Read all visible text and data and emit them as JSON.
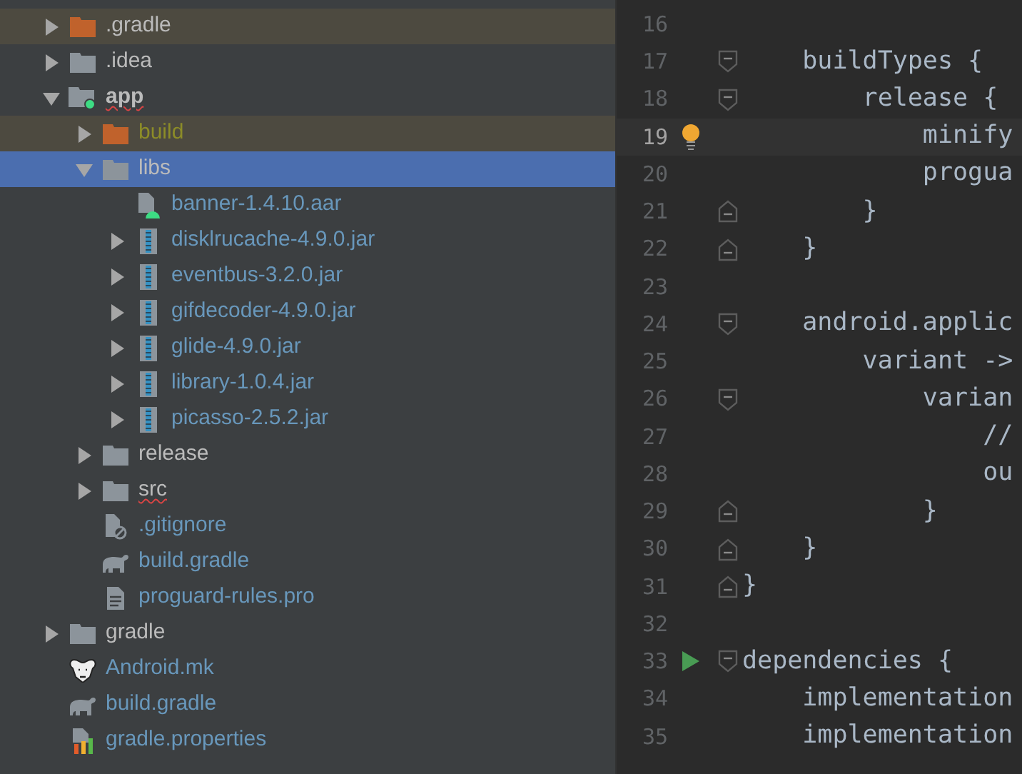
{
  "project_tree": [
    {
      "label": ".gradle",
      "kind": "folder",
      "expanded": false,
      "selected": false,
      "excluded": true,
      "bold": false,
      "spell_error": false,
      "color": "#bbbbbb"
    },
    {
      "label": ".idea",
      "kind": "folder",
      "expanded": false,
      "selected": false,
      "excluded": false,
      "bold": false,
      "spell_error": false,
      "color": "#bbbbbb"
    },
    {
      "label": "app",
      "kind": "module",
      "expanded": true,
      "selected": false,
      "excluded": false,
      "bold": true,
      "spell_error": true,
      "color": "#bbbbbb",
      "children": [
        {
          "label": "build",
          "kind": "folder",
          "expanded": false,
          "selected": false,
          "excluded": true,
          "bold": false,
          "spell_error": false,
          "color": "#8c8c28"
        },
        {
          "label": "libs",
          "kind": "folder",
          "expanded": true,
          "selected": true,
          "excluded": false,
          "bold": false,
          "spell_error": false,
          "color": "#bbbbbb",
          "children": [
            {
              "label": "banner-1.4.10.aar",
              "kind": "aar",
              "selected": false,
              "excluded": false,
              "bold": false,
              "spell_error": false,
              "color": "#6897bb"
            },
            {
              "label": "disklrucache-4.9.0.jar",
              "kind": "jar",
              "expanded": false,
              "selected": false,
              "excluded": false,
              "bold": false,
              "spell_error": false,
              "color": "#6897bb"
            },
            {
              "label": "eventbus-3.2.0.jar",
              "kind": "jar",
              "expanded": false,
              "selected": false,
              "excluded": false,
              "bold": false,
              "spell_error": false,
              "color": "#6897bb"
            },
            {
              "label": "gifdecoder-4.9.0.jar",
              "kind": "jar",
              "expanded": false,
              "selected": false,
              "excluded": false,
              "bold": false,
              "spell_error": false,
              "color": "#6897bb"
            },
            {
              "label": "glide-4.9.0.jar",
              "kind": "jar",
              "expanded": false,
              "selected": false,
              "excluded": false,
              "bold": false,
              "spell_error": false,
              "color": "#6897bb"
            },
            {
              "label": "library-1.0.4.jar",
              "kind": "jar",
              "expanded": false,
              "selected": false,
              "excluded": false,
              "bold": false,
              "spell_error": false,
              "color": "#6897bb"
            },
            {
              "label": "picasso-2.5.2.jar",
              "kind": "jar",
              "expanded": false,
              "selected": false,
              "excluded": false,
              "bold": false,
              "spell_error": false,
              "color": "#6897bb"
            }
          ]
        },
        {
          "label": "release",
          "kind": "folder",
          "expanded": false,
          "selected": false,
          "excluded": false,
          "bold": false,
          "spell_error": false,
          "color": "#bbbbbb"
        },
        {
          "label": "src",
          "kind": "folder",
          "expanded": false,
          "selected": false,
          "excluded": false,
          "bold": false,
          "spell_error": true,
          "color": "#bbbbbb"
        },
        {
          "label": ".gitignore",
          "kind": "ignore",
          "selected": false,
          "excluded": false,
          "bold": false,
          "spell_error": false,
          "color": "#6897bb"
        },
        {
          "label": "build.gradle",
          "kind": "gradle",
          "selected": false,
          "excluded": false,
          "bold": false,
          "spell_error": false,
          "color": "#6897bb"
        },
        {
          "label": "proguard-rules.pro",
          "kind": "text",
          "selected": false,
          "excluded": false,
          "bold": false,
          "spell_error": false,
          "color": "#6897bb"
        }
      ]
    },
    {
      "label": "gradle",
      "kind": "folder",
      "expanded": false,
      "selected": false,
      "excluded": false,
      "bold": false,
      "spell_error": false,
      "color": "#bbbbbb"
    },
    {
      "label": "Android.mk",
      "kind": "makefile",
      "selected": false,
      "excluded": false,
      "bold": false,
      "spell_error": false,
      "color": "#6897bb"
    },
    {
      "label": "build.gradle",
      "kind": "gradle",
      "selected": false,
      "excluded": false,
      "bold": false,
      "spell_error": false,
      "color": "#6897bb"
    },
    {
      "label": "gradle.properties",
      "kind": "properties",
      "selected": false,
      "excluded": false,
      "bold": false,
      "spell_error": false,
      "color": "#6897bb"
    }
  ],
  "editor": {
    "lines": [
      {
        "number": "16",
        "current": false,
        "fold_start": false,
        "fold_end": false,
        "bulb": false,
        "run": false
      },
      {
        "number": "17",
        "text": "    buildTypes {",
        "current": false,
        "fold_start": true,
        "fold_end": false,
        "bulb": false,
        "run": false
      },
      {
        "number": "18",
        "text": "        release {",
        "current": false,
        "fold_start": true,
        "fold_end": false,
        "bulb": false,
        "run": false
      },
      {
        "number": "19",
        "text": "            minify",
        "current": true,
        "fold_start": false,
        "fold_end": false,
        "bulb": true,
        "run": false
      },
      {
        "number": "20",
        "text": "            progua",
        "current": false,
        "fold_start": false,
        "fold_end": false,
        "bulb": false,
        "run": false
      },
      {
        "number": "21",
        "text": "        }",
        "current": false,
        "fold_start": false,
        "fold_end": true,
        "bulb": false,
        "run": false
      },
      {
        "number": "22",
        "text": "    }",
        "current": false,
        "fold_start": false,
        "fold_end": true,
        "bulb": false,
        "run": false
      },
      {
        "number": "23",
        "current": false,
        "fold_start": false,
        "fold_end": false,
        "bulb": false,
        "run": false
      },
      {
        "number": "24",
        "text": "    android.applic",
        "current": false,
        "fold_start": true,
        "fold_end": false,
        "bulb": false,
        "run": false
      },
      {
        "number": "25",
        "text": "        variant ->",
        "current": false,
        "fold_start": false,
        "fold_end": false,
        "bulb": false,
        "run": false
      },
      {
        "number": "26",
        "text": "            varian",
        "current": false,
        "fold_start": true,
        "fold_end": false,
        "bulb": false,
        "run": false
      },
      {
        "number": "27",
        "text": "                //",
        "current": false,
        "fold_start": false,
        "fold_end": false,
        "bulb": false,
        "run": false
      },
      {
        "number": "28",
        "text": "                ou",
        "current": false,
        "fold_start": false,
        "fold_end": false,
        "bulb": false,
        "run": false
      },
      {
        "number": "29",
        "text": "            }",
        "current": false,
        "fold_start": false,
        "fold_end": true,
        "bulb": false,
        "run": false
      },
      {
        "number": "30",
        "text": "    }",
        "current": false,
        "fold_start": false,
        "fold_end": true,
        "bulb": false,
        "run": false
      },
      {
        "number": "31",
        "text": "}",
        "current": false,
        "fold_start": false,
        "fold_end": true,
        "bulb": false,
        "run": false
      },
      {
        "number": "32",
        "current": false,
        "fold_start": false,
        "fold_end": false,
        "bulb": false,
        "run": false
      },
      {
        "number": "33",
        "text": "dependencies {",
        "current": false,
        "fold_start": true,
        "fold_end": false,
        "bulb": false,
        "run": true
      },
      {
        "number": "34",
        "text": "    implementation",
        "current": false,
        "fold_start": false,
        "fold_end": false,
        "bulb": false,
        "run": false
      },
      {
        "number": "35",
        "text": "    implementation",
        "current": false,
        "fold_start": false,
        "fold_end": false,
        "bulb": false,
        "run": false
      }
    ]
  }
}
